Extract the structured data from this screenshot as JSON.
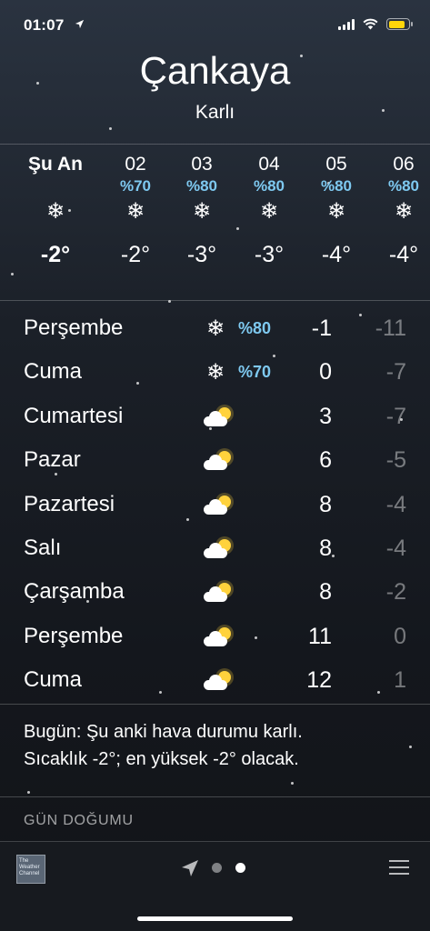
{
  "status_bar": {
    "time": "01:07",
    "location_icon": "location-arrow-icon",
    "signal_icon": "cellular-signal-icon",
    "wifi_icon": "wifi-icon",
    "battery_icon": "battery-icon",
    "battery_color": "#ffd60a",
    "battery_level_percent": 85
  },
  "header": {
    "city": "Çankaya",
    "condition": "Karlı"
  },
  "hourly": [
    {
      "label": "Şu An",
      "precip": "",
      "icon": "snowflake-icon",
      "temp": "-2°"
    },
    {
      "label": "02",
      "precip": "%70",
      "icon": "snowflake-icon",
      "temp": "-2°"
    },
    {
      "label": "03",
      "precip": "%80",
      "icon": "snowflake-icon",
      "temp": "-3°"
    },
    {
      "label": "04",
      "precip": "%80",
      "icon": "snowflake-icon",
      "temp": "-3°"
    },
    {
      "label": "05",
      "precip": "%80",
      "icon": "snowflake-icon",
      "temp": "-4°"
    },
    {
      "label": "06",
      "precip": "%80",
      "icon": "snowflake-icon",
      "temp": "-4°"
    }
  ],
  "daily": [
    {
      "day": "Perşembe",
      "icon": "snowflake-icon",
      "precip": "%80",
      "high": "-1",
      "low": "-11"
    },
    {
      "day": "Cuma",
      "icon": "snowflake-icon",
      "precip": "%70",
      "high": "0",
      "low": "-7"
    },
    {
      "day": "Cumartesi",
      "icon": "partly-cloudy-icon",
      "precip": "",
      "high": "3",
      "low": "-7"
    },
    {
      "day": "Pazar",
      "icon": "partly-cloudy-icon",
      "precip": "",
      "high": "6",
      "low": "-5"
    },
    {
      "day": "Pazartesi",
      "icon": "partly-cloudy-icon",
      "precip": "",
      "high": "8",
      "low": "-4"
    },
    {
      "day": "Salı",
      "icon": "partly-cloudy-icon",
      "precip": "",
      "high": "8",
      "low": "-4"
    },
    {
      "day": "Çarşamba",
      "icon": "partly-cloudy-icon",
      "precip": "",
      "high": "8",
      "low": "-2"
    },
    {
      "day": "Perşembe",
      "icon": "partly-cloudy-icon",
      "precip": "",
      "high": "11",
      "low": "0"
    },
    {
      "day": "Cuma",
      "icon": "partly-cloudy-icon",
      "precip": "",
      "high": "12",
      "low": "1"
    }
  ],
  "summary": {
    "line1": "Bugün: Şu anki hava durumu karlı.",
    "line2": "Sıcaklık -2°; en yüksek -2° olacak."
  },
  "details": {
    "sunrise_label": "GÜN DOĞUMU"
  },
  "toolbar": {
    "logo_text_1": "The",
    "logo_text_2": "Weather",
    "logo_text_3": "Channel",
    "location_icon": "location-arrow-icon",
    "page_count": 2,
    "current_page": 2,
    "list_icon": "list-icon"
  },
  "colors": {
    "precip": "#7ec9f0",
    "low_temp": "rgba(255,255,255,0.42)"
  }
}
